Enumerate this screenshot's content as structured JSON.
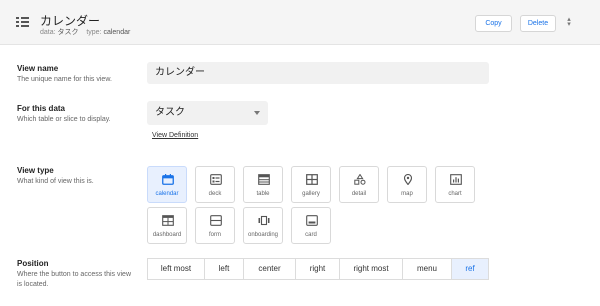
{
  "header": {
    "title": "カレンダー",
    "data_label": "data:",
    "data_value": "タスク",
    "type_label": "type:",
    "type_value": "calendar",
    "copy_label": "Copy",
    "delete_label": "Delete"
  },
  "view_name": {
    "label": "View name",
    "description": "The unique name for this view.",
    "value": "カレンダー"
  },
  "for_data": {
    "label": "For this data",
    "description": "Which table or slice to display.",
    "selected": "タスク",
    "link": "View Definition"
  },
  "view_type": {
    "label": "View type",
    "description": "What kind of view this is.",
    "options": [
      {
        "label": "calendar",
        "icon": "calendar-icon",
        "selected": true
      },
      {
        "label": "deck",
        "icon": "deck-icon",
        "selected": false
      },
      {
        "label": "table",
        "icon": "table-icon",
        "selected": false
      },
      {
        "label": "gallery",
        "icon": "gallery-icon",
        "selected": false
      },
      {
        "label": "detail",
        "icon": "detail-icon",
        "selected": false
      },
      {
        "label": "map",
        "icon": "map-icon",
        "selected": false
      },
      {
        "label": "chart",
        "icon": "chart-icon",
        "selected": false
      },
      {
        "label": "dashboard",
        "icon": "dashboard-icon",
        "selected": false
      },
      {
        "label": "form",
        "icon": "form-icon",
        "selected": false
      },
      {
        "label": "onboarding",
        "icon": "onboarding-icon",
        "selected": false
      },
      {
        "label": "card",
        "icon": "card-icon",
        "selected": false
      }
    ]
  },
  "position": {
    "label": "Position",
    "description": "Where the button to access this view is located.",
    "options": [
      "left most",
      "left",
      "center",
      "right",
      "right most",
      "menu",
      "ref"
    ],
    "selected": "ref"
  },
  "colors": {
    "accent": "#1a73e8",
    "selected_bg": "#e8f0fe",
    "header_bg": "#f5f5f5",
    "field_bg": "#f1f1f1"
  }
}
